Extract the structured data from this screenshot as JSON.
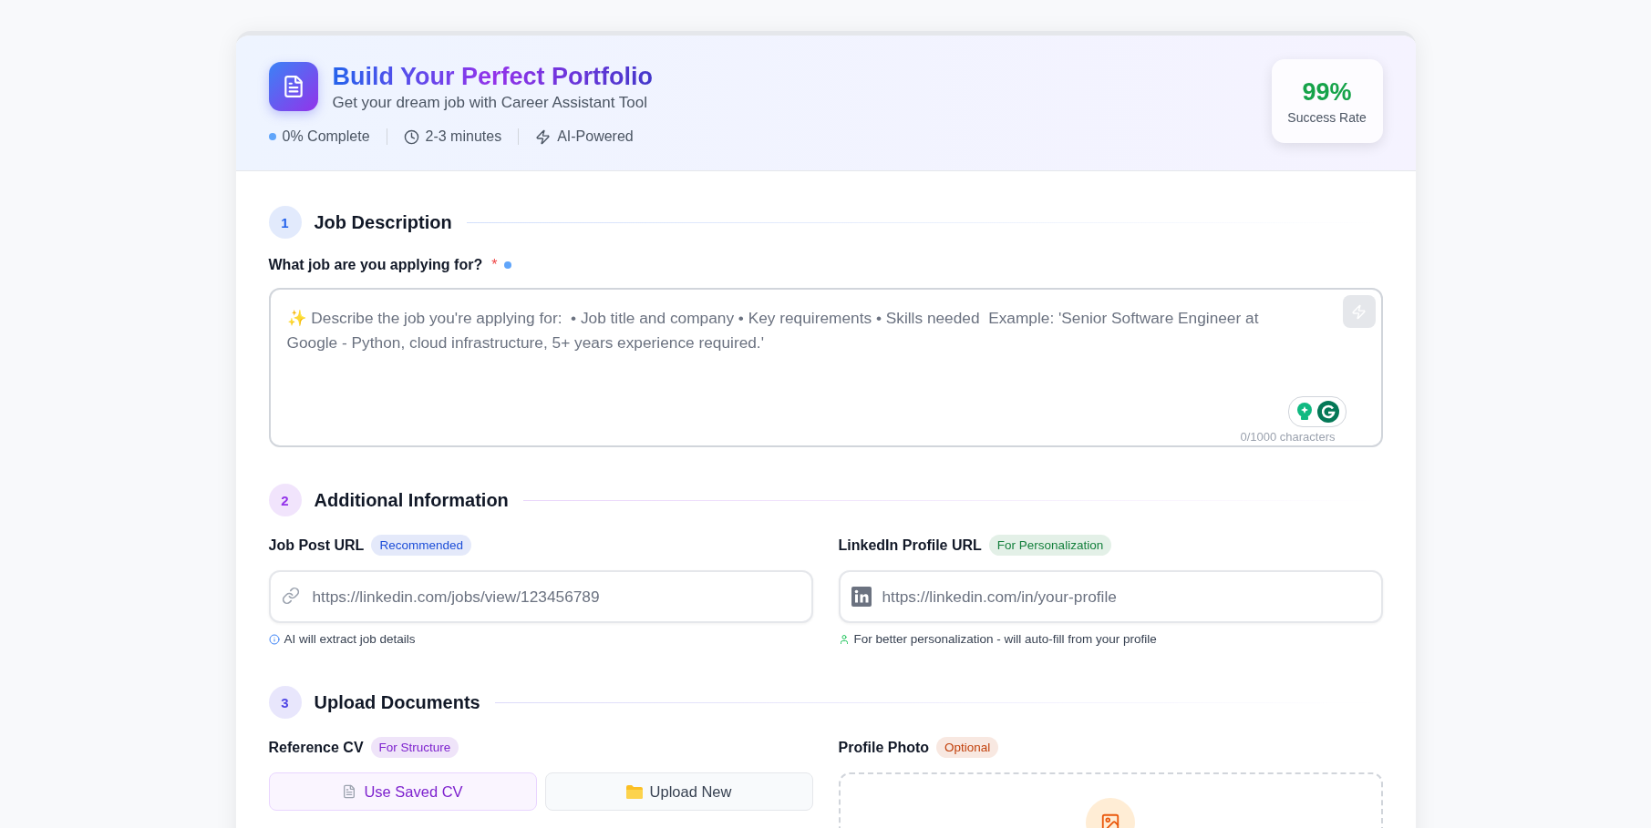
{
  "header": {
    "title": "Build Your Perfect Portfolio",
    "subtitle": "Get your dream job with Career Assistant Tool",
    "meta": [
      {
        "kind": "dot",
        "text": "0% Complete"
      },
      {
        "kind": "clock",
        "text": "2-3 minutes"
      },
      {
        "kind": "bolt",
        "text": "AI-Powered"
      }
    ],
    "stat": {
      "value": "99%",
      "label": "Success Rate"
    }
  },
  "job_description": {
    "number": "1",
    "title": "Job Description",
    "color": "#2563eb",
    "question": "What job are you applying for?",
    "required_mark": "*",
    "placeholder": "✨ Describe the job you're applying for:  • Job title and company • Key requirements • Skills needed  Example: 'Senior Software Engineer at Google - Python, cloud infrastructure, 5+ years experience required.'",
    "counter": "0/1000 characters"
  },
  "additional_information": {
    "number": "2",
    "title": "Additional Information",
    "color": "#9333ea",
    "fields": [
      {
        "label": "Job Post URL",
        "badge": {
          "text": "Recommended",
          "color": "#1d4ed8"
        },
        "kind": "link",
        "placeholder": "https://linkedin.com/jobs/view/123456789",
        "hint": "AI will extract job details"
      },
      {
        "label": "LinkedIn Profile URL",
        "badge": {
          "text": "For Personalization",
          "color": "#15803d"
        },
        "kind": "profile",
        "placeholder": "https://linkedin.com/in/your-profile",
        "hint": "For better personalization - will auto-fill from your profile"
      }
    ]
  },
  "upload_documents": {
    "number": "3",
    "title": "Upload Documents",
    "color": "#4f46e5",
    "reference_cv": {
      "label": "Reference CV",
      "badge": {
        "text": "For Structure",
        "color": "#7e22ce"
      },
      "options": [
        {
          "label": "Use Saved CV",
          "kind": "saved",
          "selected": true
        },
        {
          "label": "Upload New",
          "kind": "upload",
          "selected": false
        }
      ]
    },
    "profile_photo": {
      "label": "Profile Photo",
      "badge": {
        "text": "Optional",
        "color": "#c2410c"
      }
    }
  }
}
